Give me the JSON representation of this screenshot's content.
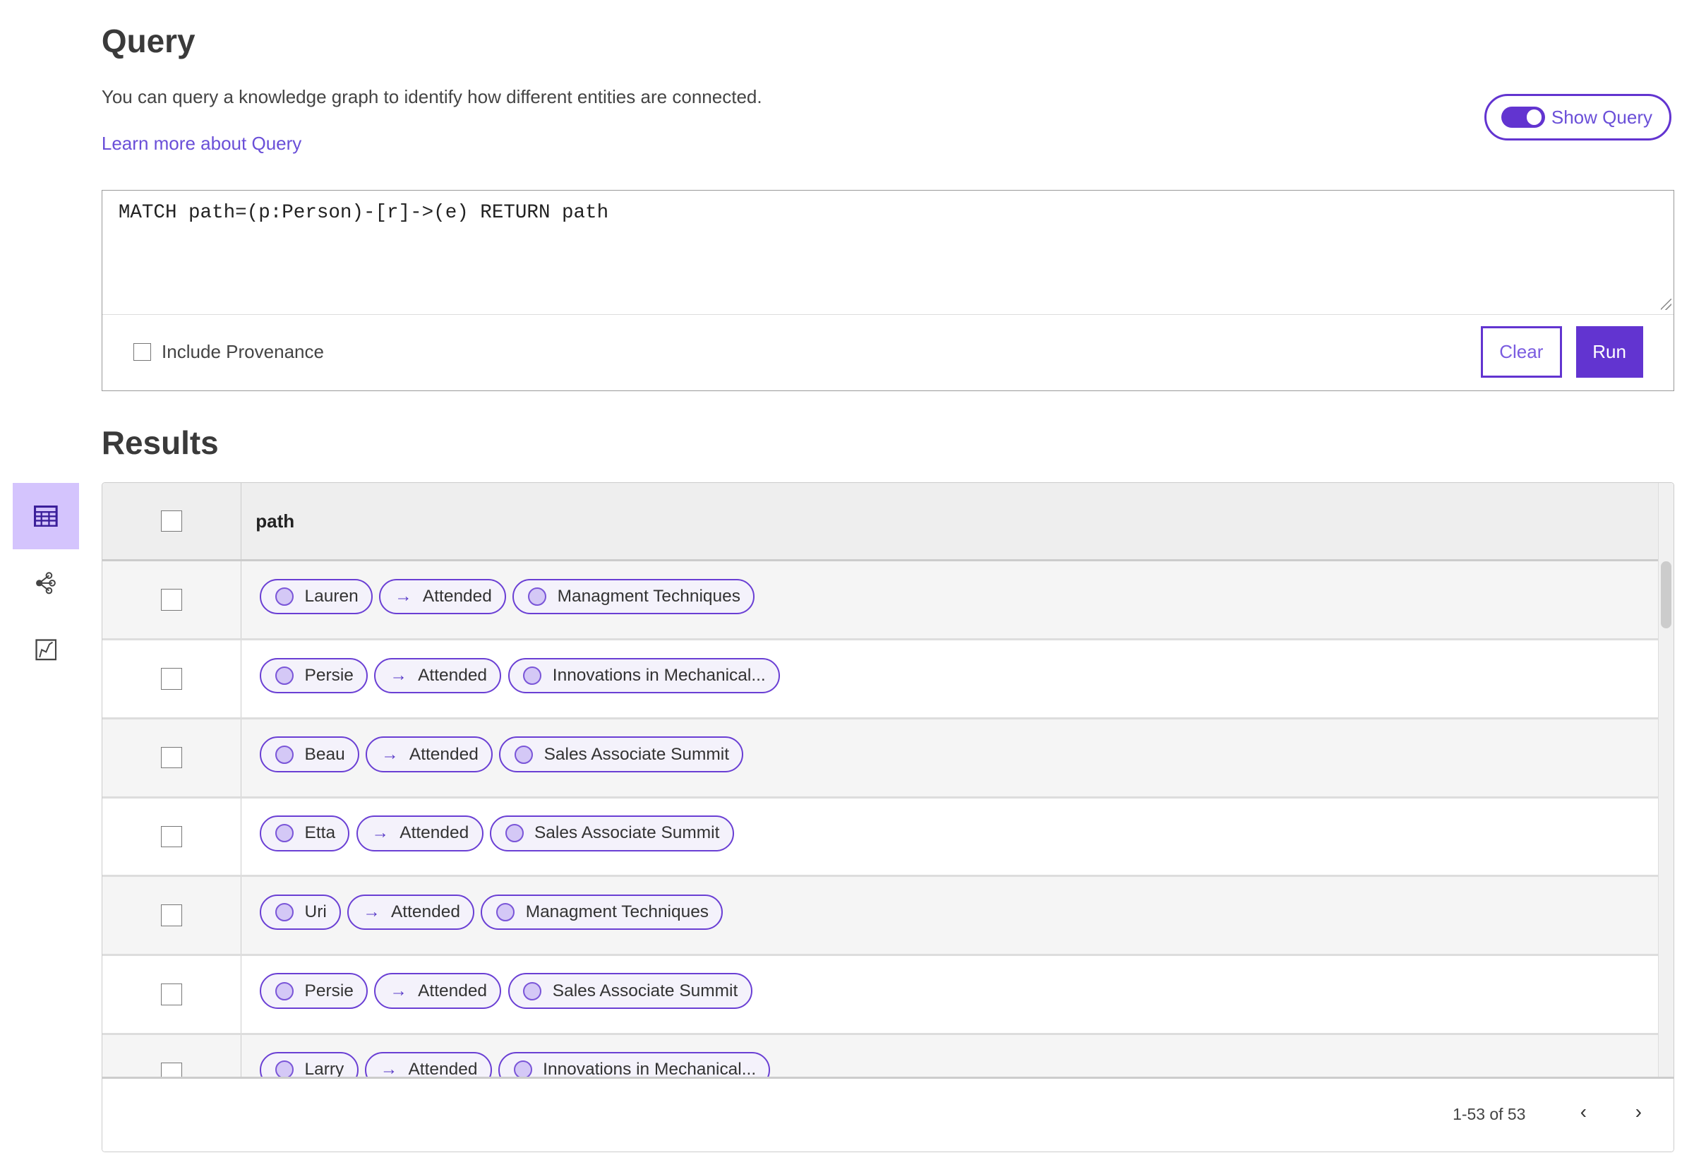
{
  "header": {
    "title": "Query",
    "description": "You can query a knowledge graph to identify how different entities are connected.",
    "learn_more": "Learn more about Query",
    "show_query_label": "Show Query",
    "show_query_on": true
  },
  "query": {
    "text": "MATCH path=(p:Person)-[r]->(e) RETURN path",
    "include_provenance_label": "Include Provenance",
    "include_provenance": false,
    "clear_label": "Clear",
    "run_label": "Run"
  },
  "results": {
    "title": "Results",
    "column": "path",
    "rows": [
      {
        "from": "Lauren",
        "rel": "Attended",
        "to": "Managment Techniques"
      },
      {
        "from": "Persie",
        "rel": "Attended",
        "to": "Innovations in Mechanical..."
      },
      {
        "from": "Beau",
        "rel": "Attended",
        "to": "Sales Associate Summit"
      },
      {
        "from": "Etta",
        "rel": "Attended",
        "to": "Sales Associate Summit"
      },
      {
        "from": "Uri",
        "rel": "Attended",
        "to": "Managment Techniques"
      },
      {
        "from": "Persie",
        "rel": "Attended",
        "to": "Sales Associate Summit"
      },
      {
        "from": "Larry",
        "rel": "Attended",
        "to": "Innovations in Mechanical..."
      }
    ],
    "pagination": "1-53 of 53"
  },
  "sidebar": {
    "items": [
      {
        "icon": "table-icon",
        "active": true
      },
      {
        "icon": "graph-icon",
        "active": false
      },
      {
        "icon": "chart-icon",
        "active": false
      }
    ]
  },
  "colors": {
    "accent": "#6234d0",
    "active_bg": "#d4c4fd",
    "chip_bg": "#f4f2fb"
  }
}
